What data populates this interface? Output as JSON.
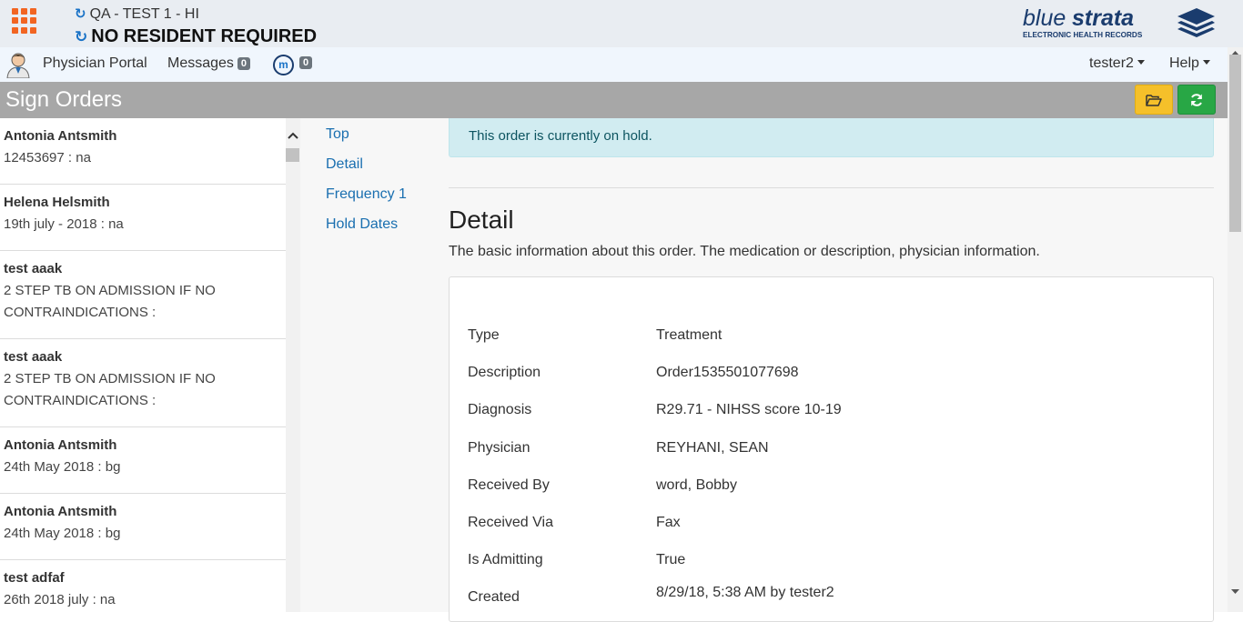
{
  "header": {
    "facility": "QA - TEST 1 - HI",
    "resident": "NO RESIDENT REQUIRED",
    "logo_word_light": "blue",
    "logo_word_bold": "strata",
    "logo_tagline": "ELECTRONIC HEALTH RECORDS",
    "brand_color": "#1a3c6e",
    "accent_color": "#f26522"
  },
  "nav": {
    "portal": "Physician Portal",
    "messages": "Messages",
    "messages_count": "0",
    "m_label": "m",
    "m_count": "0",
    "user": "tester2",
    "help": "Help"
  },
  "page": {
    "title": "Sign Orders"
  },
  "orders_list": [
    {
      "name": "Antonia Antsmith",
      "sub": "12453697 : na"
    },
    {
      "name": "Helena Helsmith",
      "sub": "19th july - 2018 : na"
    },
    {
      "name": "test aaak",
      "sub": "2 STEP TB ON ADMISSION IF NO CONTRAINDICATIONS :"
    },
    {
      "name": "test aaak",
      "sub": "2 STEP TB ON ADMISSION IF NO CONTRAINDICATIONS :"
    },
    {
      "name": "Antonia Antsmith",
      "sub": "24th May 2018 : bg"
    },
    {
      "name": "Antonia Antsmith",
      "sub": "24th May 2018 : bg"
    },
    {
      "name": "test adfaf",
      "sub": "26th 2018 july : na"
    }
  ],
  "section_nav": [
    "Top",
    "Detail",
    "Frequency 1",
    "Hold Dates"
  ],
  "alert": "This order is currently on hold.",
  "detail": {
    "heading": "Detail",
    "description": "The basic information about this order. The medication or description, physician information.",
    "fields": [
      {
        "label": "Type",
        "value": "Treatment"
      },
      {
        "label": "Description",
        "value": "Order1535501077698"
      },
      {
        "label": "Diagnosis",
        "value": "R29.71 - NIHSS score 10-19"
      },
      {
        "label": "Physician",
        "value": "REYHANI, SEAN"
      },
      {
        "label": "Received By",
        "value": "word, Bobby"
      },
      {
        "label": "Received Via",
        "value": "Fax"
      },
      {
        "label": "Is Admitting",
        "value": "True"
      },
      {
        "label": "Created",
        "value": "8/29/18, 5:38 AM by tester2"
      }
    ]
  }
}
